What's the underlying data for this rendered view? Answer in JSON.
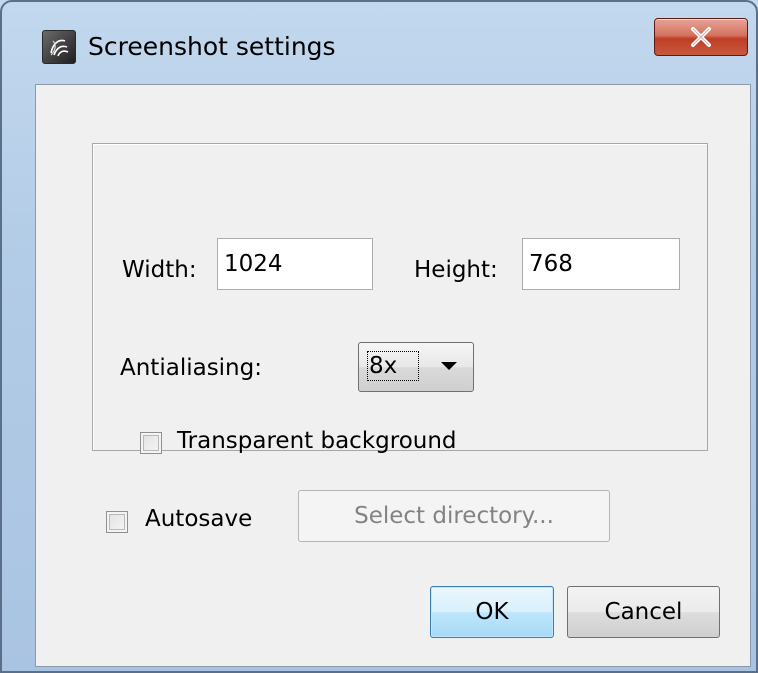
{
  "window": {
    "title": "Screenshot settings",
    "app_icon": "app-logo-icon",
    "close_icon": "close-icon"
  },
  "size": {
    "width_label": "Width:",
    "width_value": "1024",
    "height_label": "Height:",
    "height_value": "768"
  },
  "antialiasing": {
    "label": "Antialiasing:",
    "selected": "8x"
  },
  "transparent_background": {
    "label": "Transparent background",
    "checked": false
  },
  "autosave": {
    "label": "Autosave",
    "checked": false
  },
  "buttons": {
    "select_directory": "Select directory...",
    "ok": "OK",
    "cancel": "Cancel"
  },
  "colors": {
    "close_button": "#c7503b",
    "default_button_border": "#3c7fb1",
    "dialog_background": "#f0f0f0"
  }
}
